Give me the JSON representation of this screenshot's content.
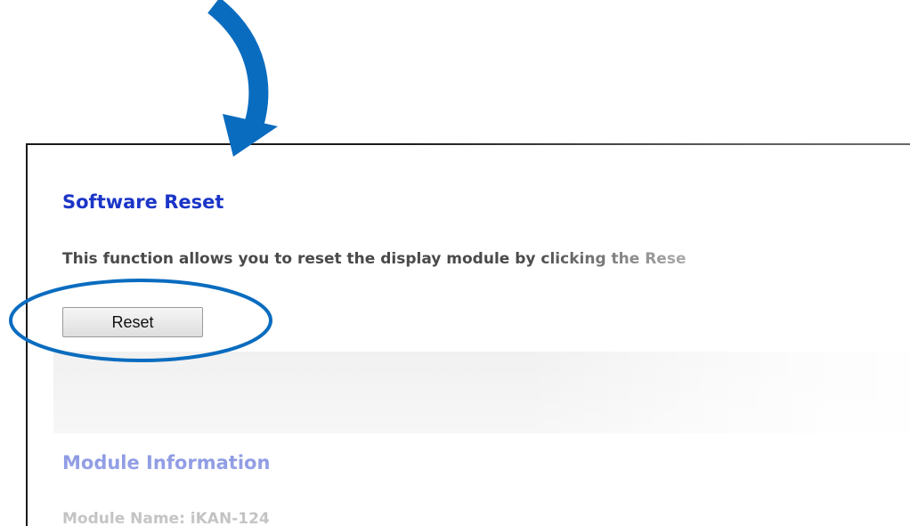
{
  "software_reset": {
    "title": "Software Reset",
    "description": "This function allows you to reset the display module by clicking the Rese",
    "reset_button_label": "Reset"
  },
  "module_information": {
    "title": "Module Information",
    "module_name": "Module Name: iKAN-124"
  },
  "annotations": {
    "arrow_icon": "curved-down-arrow-icon",
    "highlight": "ellipse-highlight",
    "color": "#0a6cbf"
  },
  "colors": {
    "title": "#1b35c8",
    "body_text": "#4a4a4a",
    "frame": "#1a1a1a"
  }
}
